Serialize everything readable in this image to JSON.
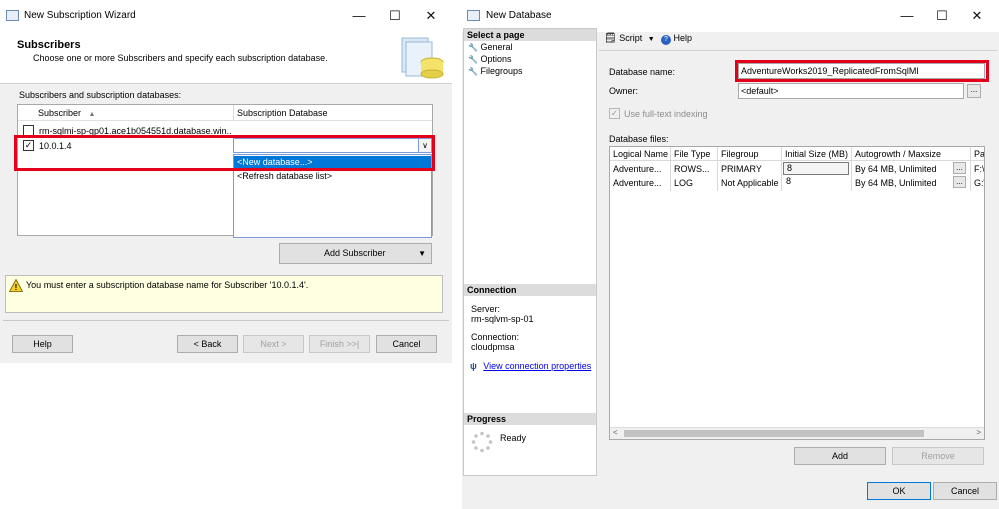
{
  "wizard": {
    "window_title": "New Subscription Wizard",
    "header_title": "Subscribers",
    "header_subtitle": "Choose one or more Subscribers and specify each subscription database.",
    "section_label": "Subscribers and subscription databases:",
    "columns": [
      "Subscriber",
      "Subscription Database"
    ],
    "rows": [
      {
        "subscriber": "rm-sqlmi-sp-gp01.ace1b054551d.database.win...",
        "database": "",
        "checked": false
      },
      {
        "subscriber": "10.0.1.4",
        "database": "",
        "checked": true
      }
    ],
    "dropdown_options": [
      "<New database...>",
      "<Refresh database list>"
    ],
    "add_subscriber_label": "Add Subscriber",
    "warning_text": "You must enter a subscription database name for Subscriber '10.0.1.4'.",
    "buttons": {
      "help": "Help",
      "back": "< Back",
      "next": "Next >",
      "finish": "Finish >>|",
      "cancel": "Cancel"
    }
  },
  "newdb": {
    "window_title": "New Database",
    "select_page_label": "Select a page",
    "pages": [
      "General",
      "Options",
      "Filegroups"
    ],
    "toolbar": {
      "script": "Script",
      "help": "Help"
    },
    "database_name_label": "Database name:",
    "database_name_value": "AdventureWorks2019_ReplicatedFromSqlMI",
    "owner_label": "Owner:",
    "owner_value": "<default>",
    "fulltext_label": "Use full-text indexing",
    "files_label": "Database files:",
    "files_columns": [
      "Logical Name",
      "File Type",
      "Filegroup",
      "Initial Size (MB)",
      "Autogrowth / Maxsize",
      "Pa"
    ],
    "files_rows": [
      {
        "logical": "Adventure...",
        "type": "ROWS...",
        "filegroup": "PRIMARY",
        "size": "8",
        "autogrowth": "By 64 MB, Unlimited",
        "path": "F:\\"
      },
      {
        "logical": "Adventure...",
        "type": "LOG",
        "filegroup": "Not Applicable",
        "size": "8",
        "autogrowth": "By 64 MB, Unlimited",
        "path": "G:\\"
      }
    ],
    "connection_label": "Connection",
    "server_label": "Server:",
    "server_value": "rm-sqlvm-sp-01",
    "connection_field_label": "Connection:",
    "connection_value": "cloudpmsa",
    "view_connection_link": "View connection properties",
    "progress_label": "Progress",
    "progress_status": "Ready",
    "buttons": {
      "add": "Add",
      "remove": "Remove",
      "ok": "OK",
      "cancel": "Cancel"
    }
  },
  "colors": {
    "highlight": "#0078d7",
    "red_box": "#e4001b",
    "warning_bg": "#ffffe1",
    "panel_head": "#dcdcdc",
    "link": "#0000ee"
  }
}
